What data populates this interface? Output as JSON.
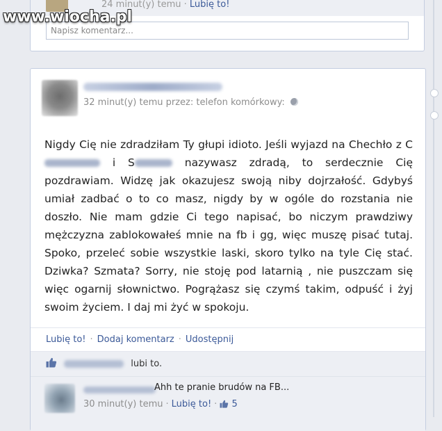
{
  "watermark": "www.wiocha.pl",
  "previous_post": {
    "comment_time": "24 minut(y) temu",
    "like_label": "Lubię to!",
    "comment_placeholder": "Napisz komentarz..."
  },
  "post": {
    "meta": "32 minut(y) temu przez: telefon komórkowy:",
    "privacy_icon": "globe-icon",
    "text_parts": [
      "Nigdy Cię nie zdradziłam Ty głupi idioto. Jeśli wyjazd na Chechło z C",
      " i S",
      " nazywasz zdradą, to serdecznie Cię pozdrawiam. Widzę jak okazujesz swoją niby dojrzałość. Gdybyś umiał zadbać o to co masz, nigdy by w ogóle do rozstania nie doszło. Nie mam gdzie Ci tego napisać, bo niczym prawdziwy mężczyzna zablokowałeś mnie na fb i gg, więc muszę pisać tutaj. Spoko, przeleć sobie wszystkie laski, skoro tylko na tyle Cię stać. Dziwka? Szmata? Sorry, nie stoję pod latarnią , nie puszczam się więc ogarnij słownictwo. Pogrążasz się czymś takim, odpuść i żyj swoim życiem. I daj mi żyć w spokoju."
    ]
  },
  "actions": {
    "like": "Lubię to!",
    "comment": "Dodaj komentarz",
    "share": "Udostępnij"
  },
  "likes": {
    "icon": "thumbs-up-icon",
    "suffix": "lubi to."
  },
  "comment": {
    "text": "Ahh te pranie brudów na FB...",
    "time": "30 minut(y) temu",
    "like_label": "Lubię to!",
    "like_count": "5"
  },
  "colors": {
    "link": "#3b5998",
    "background": "#e9ebf0",
    "card_border": "#c4cde0"
  }
}
